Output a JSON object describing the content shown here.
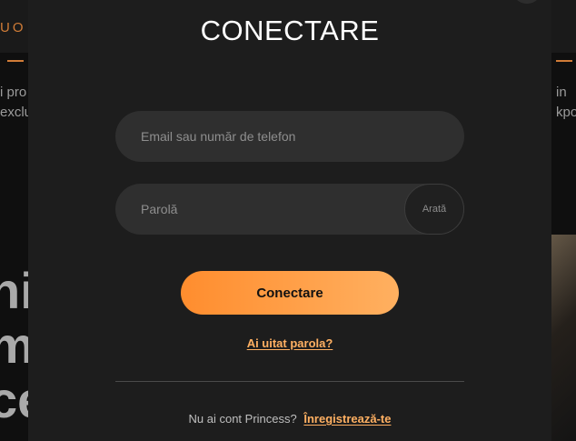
{
  "background": {
    "menu_fragment": "UO",
    "left_text_lines": [
      "i pro",
      "exclu"
    ],
    "right_text_lines": [
      "in",
      "kpo"
    ],
    "left_large_lines": [
      "hi",
      "m",
      "ce"
    ]
  },
  "modal": {
    "title": "CONECTARE",
    "email_placeholder": "Email sau număr de telefon",
    "password_placeholder": "Parolă",
    "show_password_label": "Arată",
    "login_button_label": "Conectare",
    "forgot_password_link": "Ai uitat parola?",
    "register_prompt": "Nu ai cont Princess?",
    "register_link": "Înregistrează-te"
  },
  "colors": {
    "accent": "#ffb062",
    "button_gradient_start": "#ff8d2e",
    "button_gradient_end": "#ffb060",
    "modal_background": "#1d1d1d",
    "input_background": "#2f2f2f"
  },
  "icons": {
    "close": "close-icon"
  }
}
